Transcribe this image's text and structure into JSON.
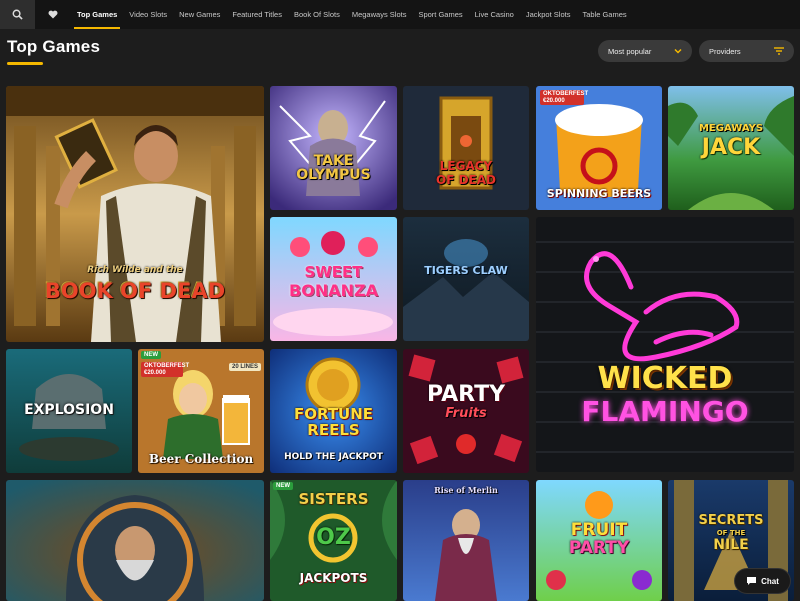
{
  "nav": {
    "tabs": [
      {
        "label": "Top Games",
        "active": true
      },
      {
        "label": "Video Slots"
      },
      {
        "label": "New Games"
      },
      {
        "label": "Featured Titles"
      },
      {
        "label": "Book Of Slots"
      },
      {
        "label": "Megaways Slots"
      },
      {
        "label": "Sport Games"
      },
      {
        "label": "Live Casino"
      },
      {
        "label": "Jackpot Slots"
      },
      {
        "label": "Table Games"
      }
    ],
    "search_icon": "search-icon",
    "favorites_icon": "heart-icon"
  },
  "header": {
    "title": "Top Games",
    "sort_label": "Most popular",
    "providers_label": "Providers"
  },
  "accent_color": "#f5b800",
  "games": {
    "book_of_dead": {
      "line1": "Rich Wilde and the",
      "line2": "BOOK OF DEAD"
    },
    "tak_olympus": {
      "line1": "TAKE",
      "line2": "OLYMPUS"
    },
    "legacy_of_dead": {
      "line1": "LEGACY",
      "line2": "OF DEAD"
    },
    "spinning_beers": {
      "title": "SPINNING BEERS",
      "badge": "OKTOBERFEST €20.000"
    },
    "megaways_jack": {
      "line1": "MEGAWAYS",
      "line2": "JACK"
    },
    "sweet_bonanza": {
      "line1": "SWEET",
      "line2": "BONANZA"
    },
    "tigers_claw": {
      "title": "TIGERS CLAW"
    },
    "wicked_flamingo": {
      "line1": "WICKED",
      "line2": "FLAMINGO"
    },
    "explosion": {
      "title": "EXPLOSION"
    },
    "beer_collection": {
      "title": "Beer Collection",
      "badge_new": "NEW",
      "badge_lines": "20 LINES",
      "badge_oktoberfest": "OKTOBERFEST €20.000"
    },
    "fortune_reels": {
      "line1": "FORTUNE",
      "line2": "REELS",
      "line3": "HOLD THE JACKPOT"
    },
    "party_fruits": {
      "line1": "PARTY",
      "line2": "Fruits"
    },
    "rise_of_merlin": {
      "title": "Rise of Merlin"
    },
    "sisters_of_oz": {
      "line1": "SISTERS",
      "line2": "OZ",
      "line3": "JACKPOTS",
      "badge_new": "NEW"
    },
    "fruit_party": {
      "line1": "FRUIT",
      "line2": "PARTY"
    },
    "secrets_of_nile": {
      "line1": "SECRETS",
      "line2": "OF THE",
      "line3": "NILE"
    }
  },
  "chat": {
    "label": "Chat"
  }
}
